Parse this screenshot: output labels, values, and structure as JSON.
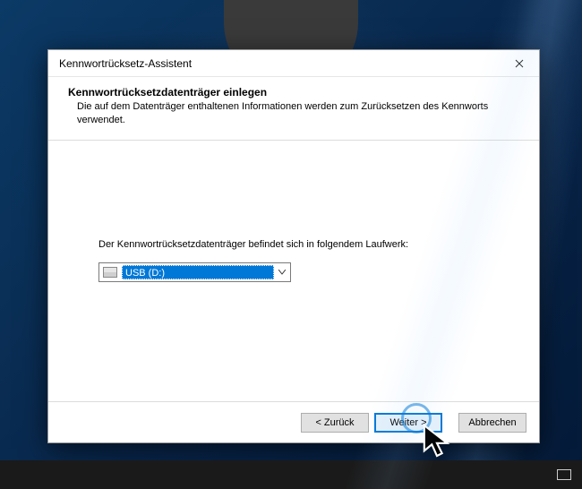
{
  "window": {
    "title": "Kennwortrücksetz-Assistent"
  },
  "header": {
    "heading": "Kennwortrücksetzdatenträger einlegen",
    "subtext": "Die auf dem Datenträger enthaltenen Informationen werden zum Zurücksetzen des Kennworts verwendet."
  },
  "content": {
    "prompt": "Der Kennwortrücksetzdatenträger befindet sich in folgendem Laufwerk:",
    "drive_selected": "USB (D:)"
  },
  "buttons": {
    "back": "< Zurück",
    "next": "Weiter >",
    "cancel": "Abbrechen"
  }
}
